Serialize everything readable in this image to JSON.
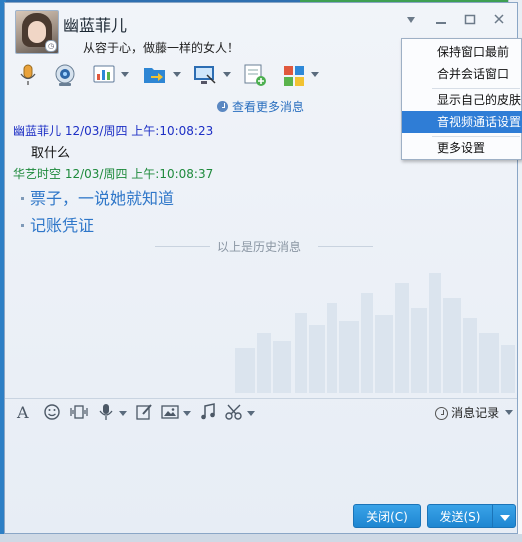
{
  "contact": {
    "name": "幽蓝菲儿",
    "signature": "从容于心，做藤一样的女人！"
  },
  "window_controls": [
    "dropdown-arrow",
    "minimize",
    "maximize",
    "close"
  ],
  "toolbar": {
    "items": [
      {
        "icon": "microphone-icon"
      },
      {
        "icon": "webcam-icon"
      },
      {
        "icon": "app-chart-icon"
      },
      {
        "icon": "file-transfer-icon"
      },
      {
        "icon": "remote-desktop-icon"
      },
      {
        "icon": "create-group-icon"
      },
      {
        "icon": "apps-grid-icon"
      }
    ]
  },
  "chat": {
    "more_messages": "查看更多消息",
    "messages": [
      {
        "sender": "幽蓝菲儿",
        "time": "12/03/周四 上午:10:08:23",
        "text": "取什么",
        "color": "#1d2fc5"
      },
      {
        "sender": "华艺时空",
        "time": "12/03/周四 上午:10:08:37",
        "lines": [
          "票子，一说她就知道",
          "记账凭证"
        ],
        "color": "#1e8a3c"
      }
    ],
    "history_divider": "以上是历史消息"
  },
  "input_toolbar": {
    "icons": [
      "font-icon",
      "emoji-icon",
      "shake-icon",
      "voice-icon",
      "edit-icon",
      "image-icon",
      "music-icon",
      "scissors-icon"
    ],
    "history_label": "消息记录"
  },
  "buttons": {
    "close": "关闭(C)",
    "send": "发送(S)"
  },
  "menu": {
    "items": [
      "保持窗口最前",
      "合并会话窗口",
      "显示自己的皮肤",
      "音视频通话设置",
      "更多设置"
    ],
    "highlighted_index": 3
  },
  "colors": {
    "accent": "#2f7dd6",
    "button": "#1e86d1",
    "link": "#2a6fbf"
  }
}
